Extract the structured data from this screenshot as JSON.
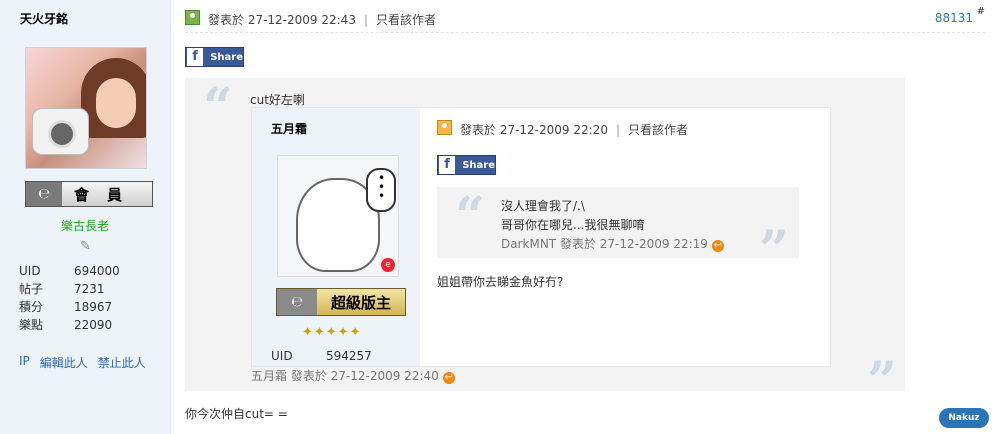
{
  "sidebar": {
    "username": "天火牙銘",
    "rank_badge": "會員",
    "rank_title": "樂古長老",
    "stats": [
      {
        "key": "UID",
        "value": "694000"
      },
      {
        "key": "帖子",
        "value": "7231"
      },
      {
        "key": "積分",
        "value": "18967"
      },
      {
        "key": "樂點",
        "value": "22090"
      }
    ],
    "actions": [
      "IP",
      "編輯此人",
      "禁止此人"
    ]
  },
  "post": {
    "meta": "發表於 27-12-2009 22:43",
    "only_author": "只看該作者",
    "post_number": "88131",
    "hash": "#",
    "share_label": "Share",
    "outer_quote_text": "cut好左喇",
    "final_text": "你今次仲自cut= ="
  },
  "inner_post": {
    "username": "五月霜",
    "badge": "超級版主",
    "uid_key": "UID",
    "uid_value": "594257",
    "meta": "發表於 27-12-2009 22:20",
    "only_author": "只看該作者",
    "share_label": "Share",
    "deep_quote_line1": "沒人理會我了/.\\",
    "deep_quote_line2": "哥哥你在哪兒...我很無聊唷",
    "deep_quote_sig": "DarkMNT 發表於 27-12-2009 22:19",
    "reply_text": "姐姐帶你去睇金魚好冇?",
    "outer_sig": "五月霜 發表於 27-12-2009 22:40"
  },
  "watermark": "Nakuz",
  "colors": {
    "accent": "#2a7ab8",
    "rank_green": "#1aa51a",
    "facebook": "#3b5998"
  }
}
